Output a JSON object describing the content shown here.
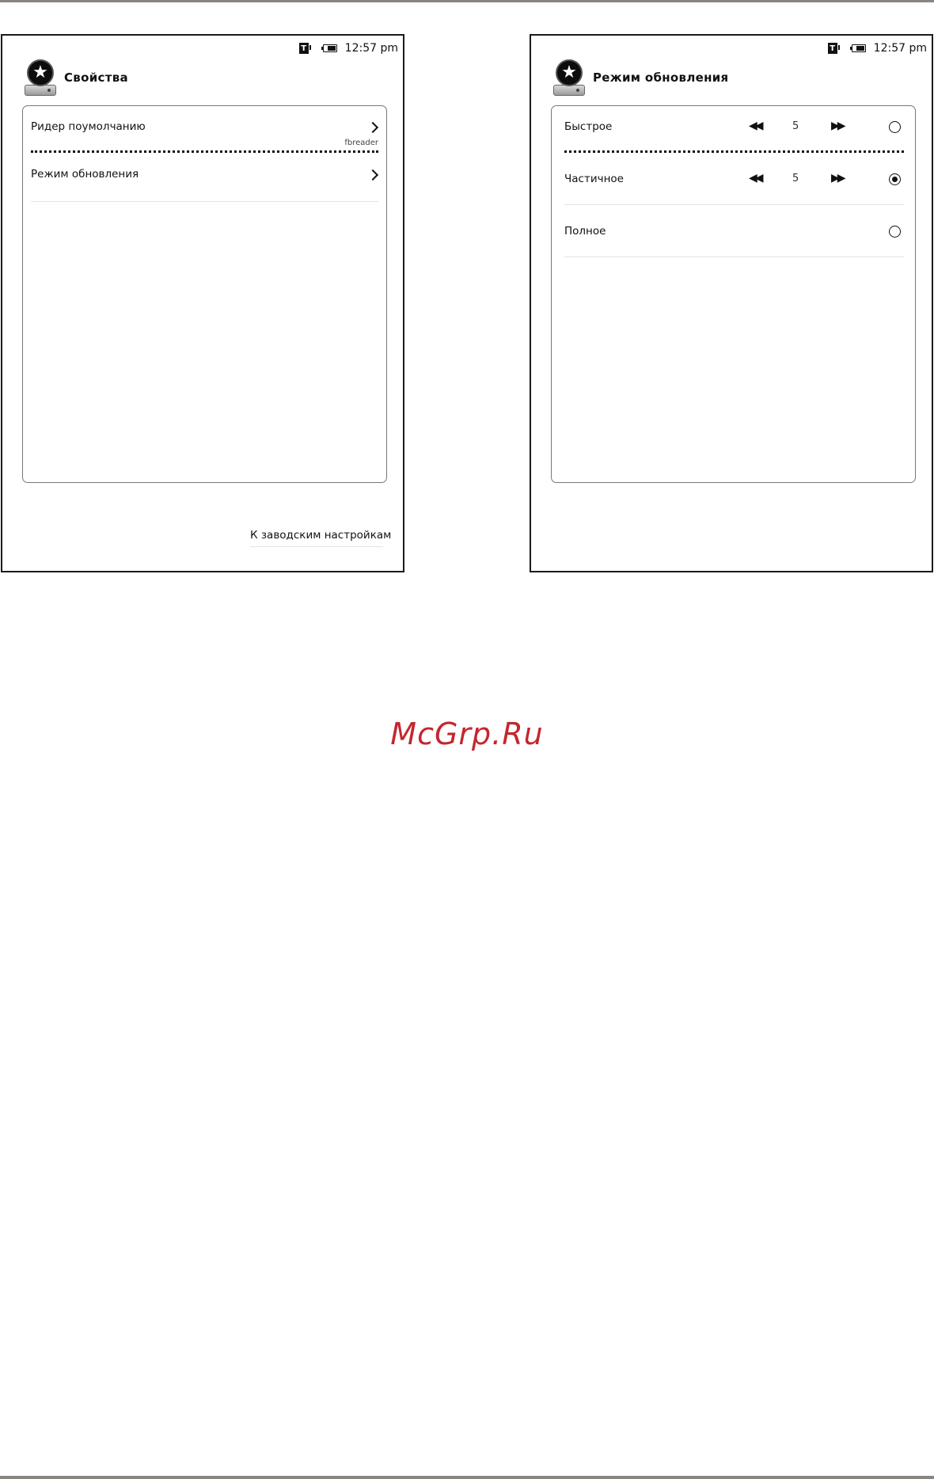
{
  "left_screen": {
    "status": {
      "time": "12:57 pm",
      "icons": [
        "t-notification-icon",
        "battery-icon"
      ]
    },
    "header": {
      "title": "Свойства",
      "icon": "star-disk-icon"
    },
    "items": [
      {
        "label": "Ридер поумолчанию",
        "value": "fbreader",
        "icon": "chevron-right-icon"
      },
      {
        "label": "Режим обновления",
        "icon": "chevron-right-icon"
      }
    ],
    "footer_link": "К заводским настройкам"
  },
  "right_screen": {
    "status": {
      "time": "12:57 pm",
      "icons": [
        "t-notification-icon",
        "battery-icon"
      ]
    },
    "header": {
      "title": "Режим обновления",
      "icon": "star-disk-icon"
    },
    "options": [
      {
        "label": "Быстрое",
        "value": "5",
        "selected": false
      },
      {
        "label": "Частичное",
        "value": "5",
        "selected": true
      },
      {
        "label": "Полное",
        "selected": false
      }
    ]
  },
  "watermark": "McGrp.Ru"
}
